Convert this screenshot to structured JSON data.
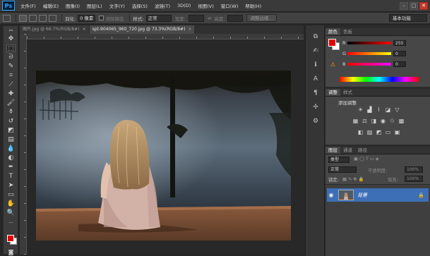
{
  "app": {
    "logo": "Ps"
  },
  "menubar": {
    "items": [
      "文件(F)",
      "编辑(E)",
      "图像(I)",
      "图层(L)",
      "文字(Y)",
      "选择(S)",
      "滤镜(T)",
      "3D(D)",
      "视图(V)",
      "窗口(W)",
      "帮助(H)"
    ],
    "win_controls": {
      "minimize": "–",
      "restore": "□",
      "close": "✕"
    }
  },
  "options": {
    "feather_label": "羽化:",
    "feather_value": "0 像素",
    "antialias_label": "消除锯齿",
    "style_label": "样式:",
    "style_value": "正常",
    "width_label": "宽度:",
    "height_label": "高度:",
    "refine_edge": "调整边缘...",
    "workspace": "基本功能"
  },
  "tabs": [
    {
      "label": "图片.jpg @ 66.7%(RGB/8#)",
      "close": "×",
      "active": false
    },
    {
      "label": "spt-904065_960_720.jpg @ 73.3%(RGB/8#)",
      "close": "×",
      "active": true
    }
  ],
  "panels": {
    "color": {
      "tabs": [
        "颜色",
        "色板"
      ],
      "r": "R",
      "g": "G",
      "b": "B",
      "r_val": "255",
      "g_val": "0",
      "b_val": "0",
      "fg_color": "#e10000"
    },
    "adjustments": {
      "tabs": [
        "调整",
        "样式"
      ],
      "title": "添加调整"
    },
    "layers": {
      "tabs": [
        "图层",
        "通道",
        "路径"
      ],
      "kind_label": "类型",
      "blend_mode": "正常",
      "opacity_label": "不透明度:",
      "opacity_value": "100%",
      "lock_label": "锁定:",
      "fill_label": "填充:",
      "fill_value": "100%",
      "layer_name": "背景"
    }
  }
}
